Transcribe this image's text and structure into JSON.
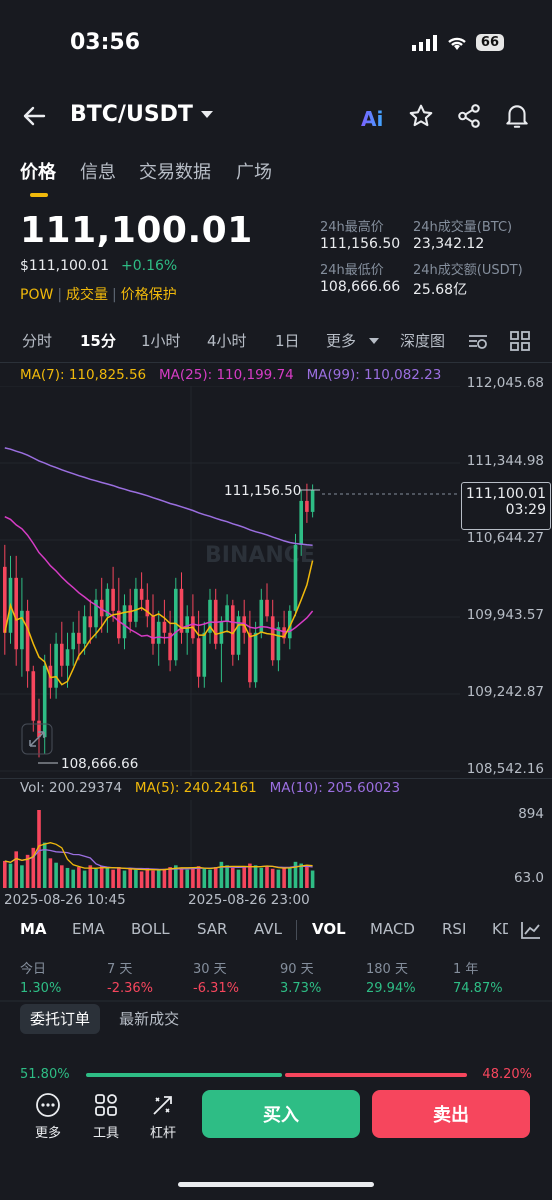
{
  "status": {
    "time": "03:56",
    "battery": "66"
  },
  "nav": {
    "back_icon": "arrow-left-icon",
    "pair": "BTC/USDT"
  },
  "tabs": [
    "价格",
    "信息",
    "交易数据",
    "广场"
  ],
  "price": {
    "last": "111,100.01",
    "usd": "$111,100.01",
    "change": "+0.16%",
    "tags": [
      "POW",
      "成交量",
      "价格保护"
    ]
  },
  "stats": {
    "high_label": "24h最高价",
    "high": "111,156.50",
    "vol_btc_label": "24h成交量(BTC)",
    "vol_btc": "23,342.12",
    "low_label": "24h最低价",
    "low": "108,666.66",
    "vol_usdt_label": "24h成交额(USDT)",
    "vol_usdt": "25.68亿"
  },
  "intervals": [
    "分时",
    "15分",
    "1小时",
    "4小时",
    "1日",
    "更多",
    "深度图"
  ],
  "ma": {
    "ma7": "MA(7): 110,825.56",
    "ma25": "MA(25): 110,199.74",
    "ma99": "MA(99): 110,082.23"
  },
  "price_axis": [
    "112,045.68",
    "111,344.98",
    "110,644.27",
    "109,943.57",
    "109,242.87",
    "108,542.16"
  ],
  "chart_annotations": {
    "high_marker": "111,156.50",
    "low_marker": "108,666.66",
    "current_price": "111,100.01",
    "countdown": "03:29",
    "watermark": "BINANCE"
  },
  "volume": {
    "vol": "Vol: 200.29374",
    "ma5": "MA(5): 240.24161",
    "ma10": "MA(10): 205.60023",
    "axis_top": "894",
    "axis_bottom": "63.0"
  },
  "time_axis": [
    "2025-08-26 10:45",
    "2025-08-26 23:00"
  ],
  "indicators": [
    "MA",
    "EMA",
    "BOLL",
    "SAR",
    "AVL",
    "VOL",
    "MACD",
    "RSI",
    "KD"
  ],
  "performance": [
    {
      "label": "今日",
      "value": "1.30%"
    },
    {
      "label": "7 天",
      "value": "-2.36%"
    },
    {
      "label": "30 天",
      "value": "-6.31%"
    },
    {
      "label": "90 天",
      "value": "3.73%"
    },
    {
      "label": "180 天",
      "value": "29.94%"
    },
    {
      "label": "1 年",
      "value": "74.87%"
    }
  ],
  "orders": {
    "tab_active": "委托订单",
    "tab_other": "最新成交",
    "buy_ratio": "51.80%",
    "sell_ratio": "48.20%"
  },
  "bottom": {
    "more": "更多",
    "tools": "工具",
    "leverage": "杠杆",
    "buy": "买入",
    "sell": "卖出"
  },
  "colors": {
    "up": "#2ebd85",
    "down": "#f6465d",
    "accent": "#f0b90b",
    "ma7": "#f0b90b",
    "ma25": "#d63cc5",
    "ma99": "#9b6fe0"
  },
  "chart_data": {
    "type": "candlestick",
    "ylim": [
      108542.16,
      112045.68
    ],
    "candles": [
      [
        110400,
        110600,
        109600,
        109800
      ],
      [
        109800,
        110500,
        109700,
        110300
      ],
      [
        110300,
        110500,
        109500,
        109650
      ],
      [
        109650,
        110300,
        109400,
        110000
      ],
      [
        110000,
        110100,
        109300,
        109450
      ],
      [
        109450,
        109500,
        108900,
        109000
      ],
      [
        109000,
        109200,
        108666.66,
        108850
      ],
      [
        108850,
        109600,
        108700,
        109500
      ],
      [
        109500,
        109700,
        109200,
        109300
      ],
      [
        109300,
        109800,
        109200,
        109700
      ],
      [
        109700,
        109900,
        109400,
        109500
      ],
      [
        109500,
        109800,
        109300,
        109650
      ],
      [
        109650,
        109900,
        109500,
        109800
      ],
      [
        109800,
        110000,
        109550,
        109700
      ],
      [
        109700,
        110050,
        109600,
        109950
      ],
      [
        109950,
        110100,
        109700,
        109850
      ],
      [
        109850,
        110200,
        109750,
        110100
      ],
      [
        110100,
        110300,
        109800,
        109950
      ],
      [
        109950,
        110250,
        109800,
        110200
      ],
      [
        110200,
        110400,
        109900,
        110000
      ],
      [
        110000,
        110300,
        109700,
        109750
      ],
      [
        109750,
        110150,
        109650,
        110050
      ],
      [
        110050,
        110200,
        109800,
        109900
      ],
      [
        109900,
        110300,
        109850,
        110200
      ],
      [
        110200,
        110350,
        110000,
        110100
      ],
      [
        110100,
        110250,
        109850,
        109950
      ],
      [
        109950,
        110150,
        109600,
        109700
      ],
      [
        109700,
        110000,
        109500,
        109900
      ],
      [
        109900,
        110100,
        109700,
        109800
      ],
      [
        109800,
        110000,
        109450,
        109550
      ],
      [
        109550,
        110300,
        109500,
        110200
      ],
      [
        110200,
        110350,
        109700,
        109800
      ],
      [
        109800,
        110050,
        109600,
        109950
      ],
      [
        109950,
        110150,
        109700,
        109750
      ],
      [
        109750,
        110000,
        109300,
        109400
      ],
      [
        109400,
        109900,
        109300,
        109800
      ],
      [
        109800,
        110200,
        109700,
        110100
      ],
      [
        110100,
        110200,
        109650,
        109700
      ],
      [
        109700,
        109950,
        109350,
        109900
      ],
      [
        109900,
        110150,
        109800,
        110050
      ],
      [
        110050,
        110100,
        109500,
        109600
      ],
      [
        109600,
        110000,
        109550,
        109950
      ],
      [
        109950,
        110100,
        109700,
        109800
      ],
      [
        109800,
        110000,
        109300,
        109350
      ],
      [
        109350,
        109900,
        109300,
        109800
      ],
      [
        109800,
        110200,
        109750,
        110100
      ],
      [
        110100,
        110250,
        109900,
        109950
      ],
      [
        109950,
        110100,
        109500,
        109550
      ],
      [
        109550,
        109900,
        109450,
        109850
      ],
      [
        109850,
        110000,
        109700,
        109750
      ],
      [
        109750,
        110050,
        109650,
        110000
      ],
      [
        110000,
        110700,
        109950,
        110600
      ],
      [
        110600,
        111100,
        110500,
        111000
      ],
      [
        111000,
        111156.5,
        110800,
        110900
      ],
      [
        110900,
        111150,
        110850,
        111100.01
      ]
    ],
    "volumes": [
      310,
      280,
      420,
      260,
      380,
      460,
      894,
      520,
      340,
      290,
      260,
      230,
      210,
      240,
      200,
      260,
      220,
      250,
      230,
      210,
      240,
      200,
      220,
      210,
      190,
      230,
      200,
      210,
      220,
      240,
      260,
      230,
      210,
      230,
      250,
      220,
      210,
      240,
      300,
      260,
      230,
      210,
      240,
      280,
      260,
      230,
      250,
      220,
      210,
      230,
      240,
      300,
      280,
      260,
      200.29
    ]
  }
}
